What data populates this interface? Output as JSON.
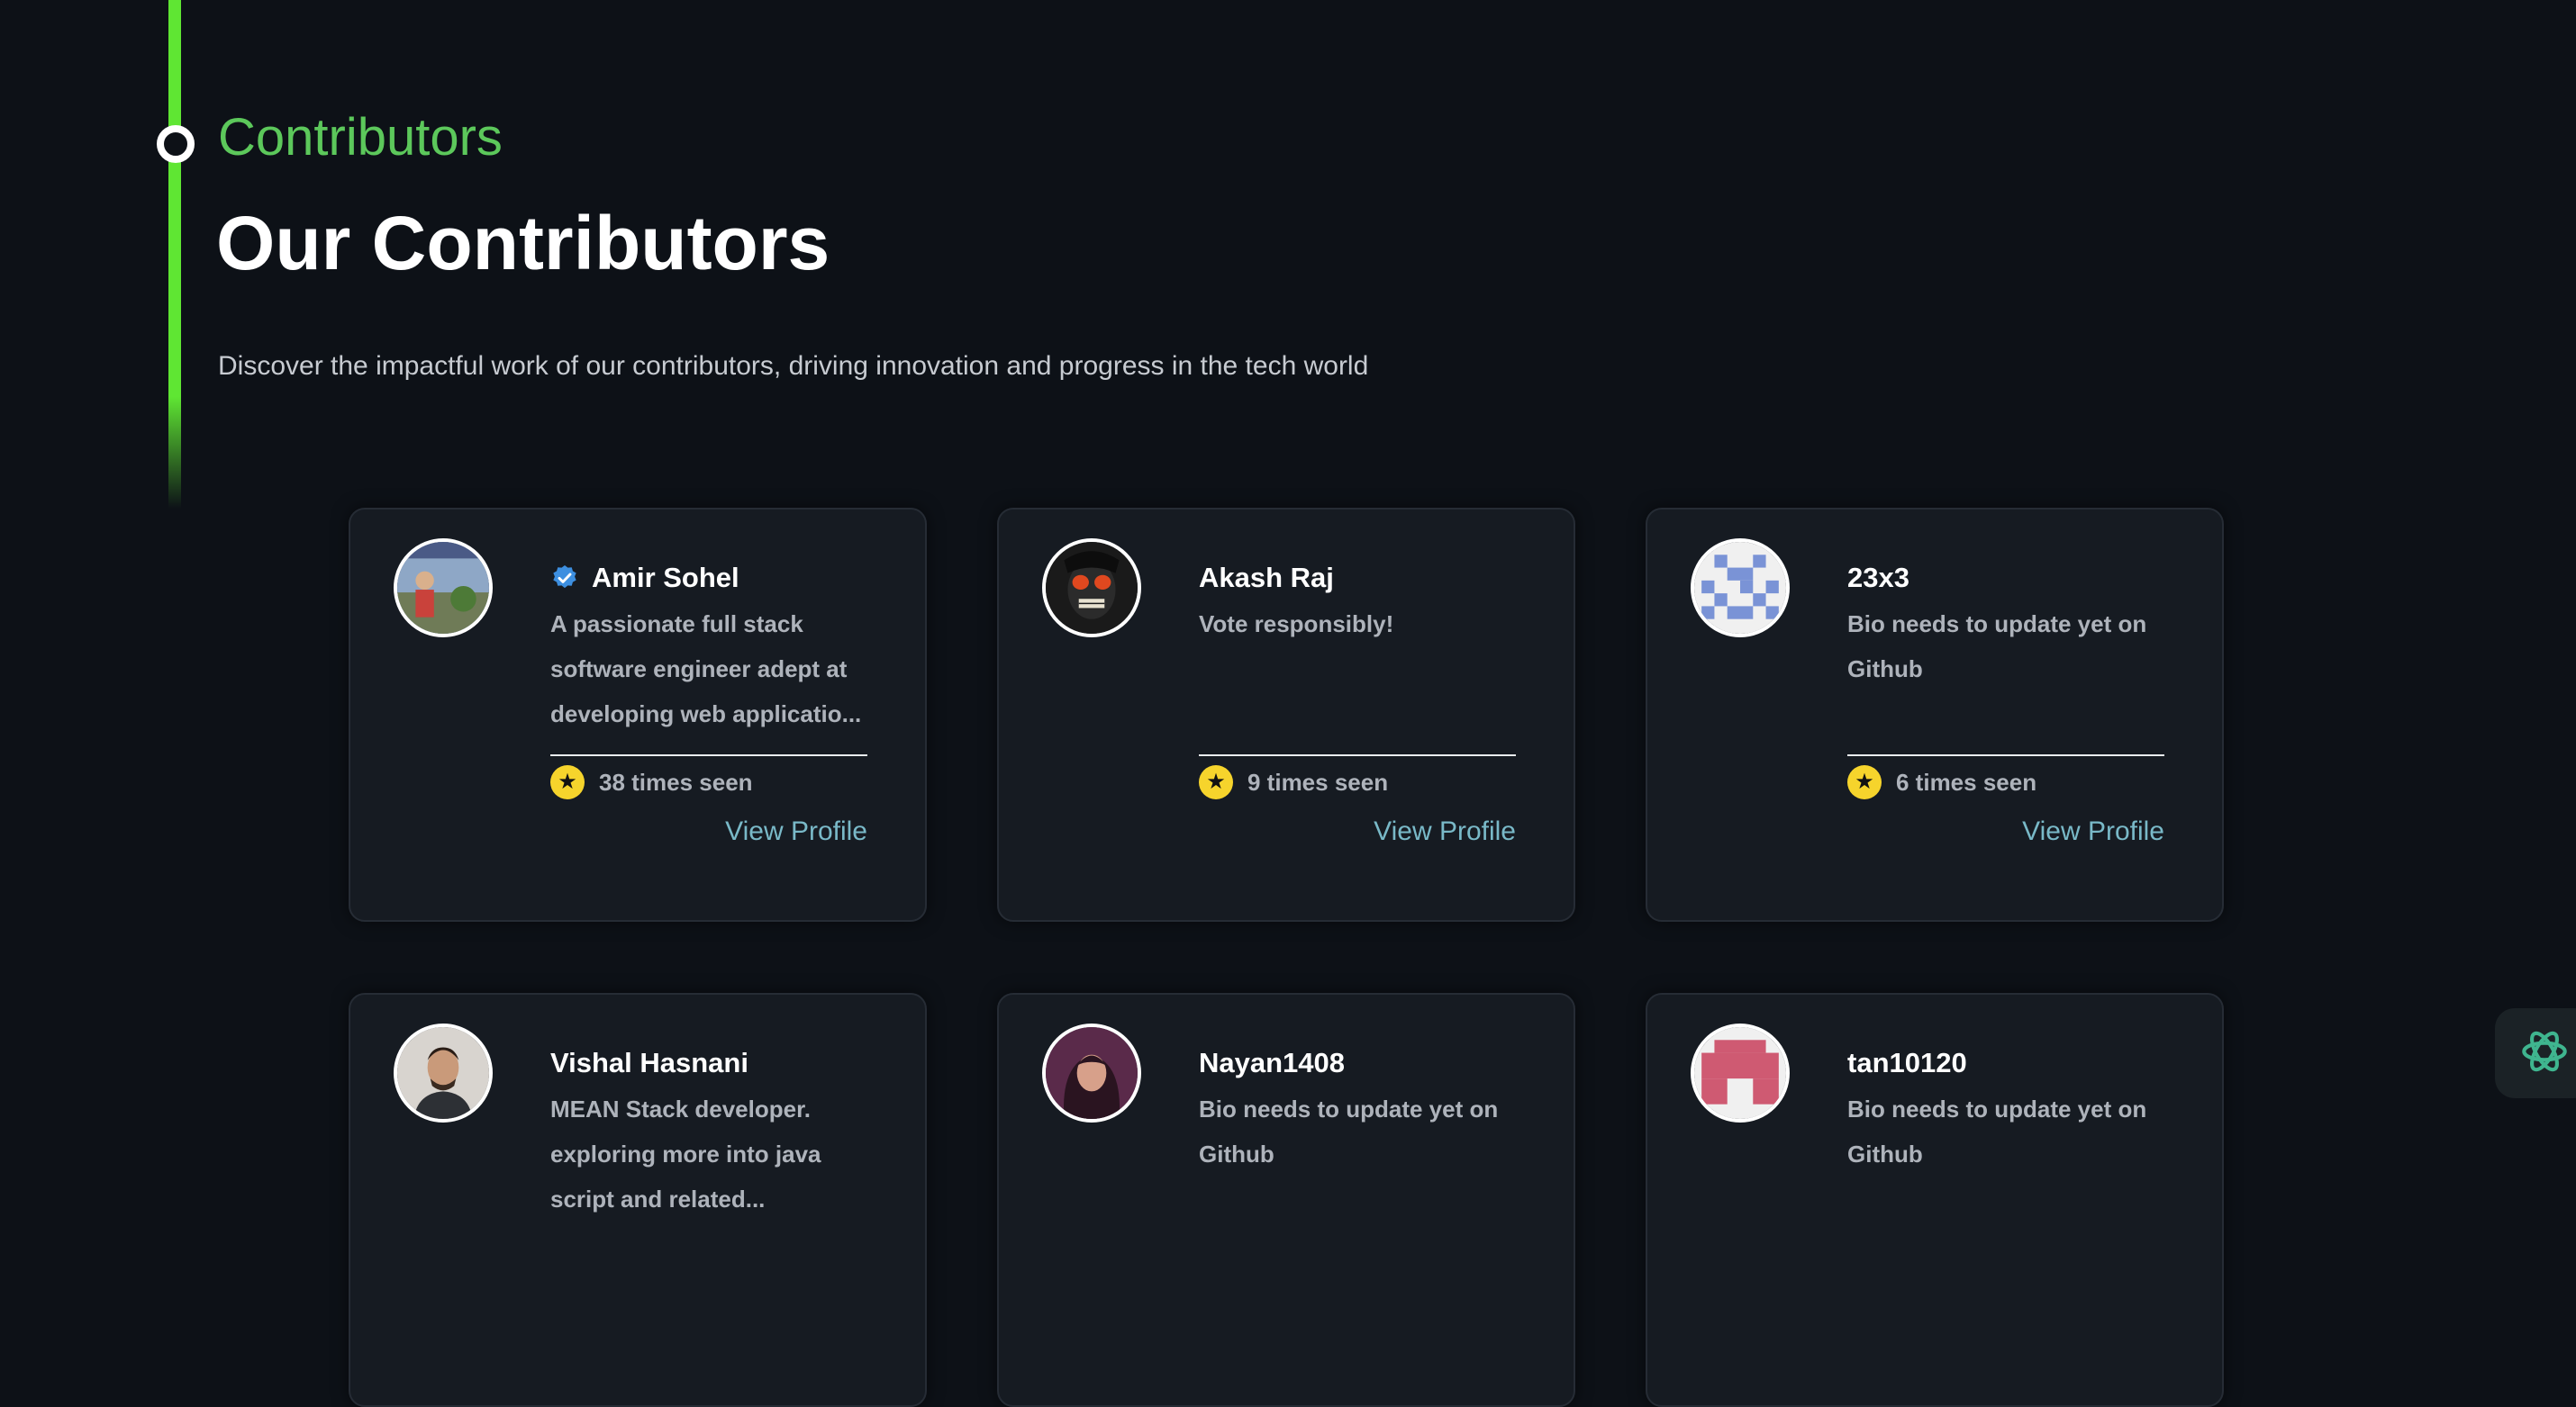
{
  "section": {
    "eyebrow": "Contributors",
    "title": "Our Contributors",
    "subtitle": "Discover the impactful work of our contributors, driving innovation and progress in the tech world"
  },
  "colors": {
    "accent_green": "#5fe633",
    "eyebrow_green": "#5cc85b",
    "link": "#79b9c8",
    "star": "#f6d42c",
    "verified": "#3d8fe0"
  },
  "contributors": [
    {
      "name": "Amir Sohel",
      "verified": true,
      "bio": "A passionate full stack software engineer adept at developing web applicatio...",
      "seen": "38 times seen",
      "link_label": "View Profile"
    },
    {
      "name": "Akash Raj",
      "verified": false,
      "bio": "Vote responsibly!",
      "seen": "9 times seen",
      "link_label": "View Profile"
    },
    {
      "name": "23x3",
      "verified": false,
      "bio": "Bio needs to update yet on Github",
      "seen": "6 times seen",
      "link_label": "View Profile"
    },
    {
      "name": "Vishal Hasnani",
      "verified": false,
      "bio": "MEAN Stack developer. exploring more into java script and related...",
      "seen": "",
      "link_label": ""
    },
    {
      "name": "Nayan1408",
      "verified": false,
      "bio": "Bio needs to update yet on Github",
      "seen": "",
      "link_label": ""
    },
    {
      "name": "tan10120",
      "verified": false,
      "bio": "Bio needs to update yet on Github",
      "seen": "",
      "link_label": ""
    }
  ],
  "icons": {
    "verified": "verified-badge-icon",
    "star": "star-icon",
    "assistant": "openai-logo-icon"
  }
}
